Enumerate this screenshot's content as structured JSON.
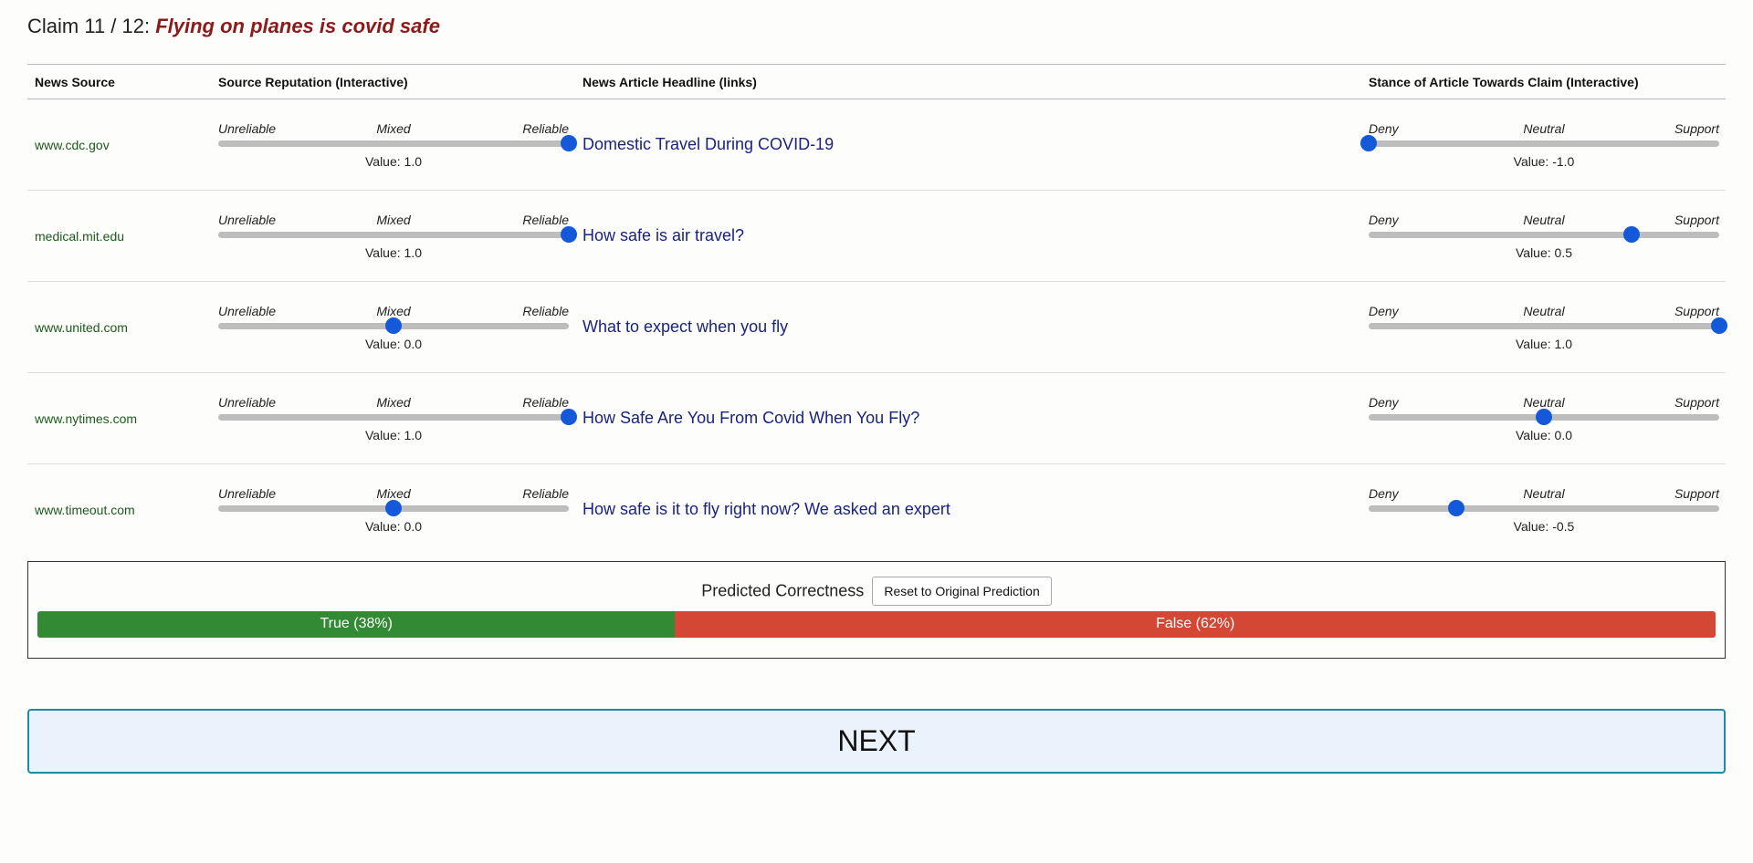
{
  "claim": {
    "prefix": "Claim 11 / 12: ",
    "text": "Flying on planes is covid safe"
  },
  "table": {
    "headers": {
      "source": "News Source",
      "reputation": "Source Reputation (Interactive)",
      "headline": "News Article Headline (links)",
      "stance": "Stance of Article Towards Claim (Interactive)"
    },
    "reputation_labels": [
      "Unreliable",
      "Mixed",
      "Reliable"
    ],
    "stance_labels": [
      "Deny",
      "Neutral",
      "Support"
    ],
    "value_prefix": "Value: ",
    "scale": [
      -1,
      1
    ],
    "rows": [
      {
        "source": "www.cdc.gov",
        "reputation": 1.0,
        "reputation_text": "1.0",
        "headline": "Domestic Travel During COVID-19",
        "stance": -1.0,
        "stance_text": "-1.0"
      },
      {
        "source": "medical.mit.edu",
        "reputation": 1.0,
        "reputation_text": "1.0",
        "headline": "How safe is air travel?",
        "stance": 0.5,
        "stance_text": "0.5"
      },
      {
        "source": "www.united.com",
        "reputation": 0.0,
        "reputation_text": "0.0",
        "headline": "What to expect when you fly",
        "stance": 1.0,
        "stance_text": "1.0"
      },
      {
        "source": "www.nytimes.com",
        "reputation": 1.0,
        "reputation_text": "1.0",
        "headline": "How Safe Are You From Covid When You Fly?",
        "stance": 0.0,
        "stance_text": "0.0"
      },
      {
        "source": "www.timeout.com",
        "reputation": 0.0,
        "reputation_text": "0.0",
        "headline": "How safe is it to fly right now? We asked an expert",
        "stance": -0.5,
        "stance_text": "-0.5"
      }
    ]
  },
  "prediction": {
    "title": "Predicted Correctness",
    "reset_label": "Reset to Original Prediction",
    "true_label": "True (38%)",
    "false_label": "False (62%)",
    "true_fraction": 0.38,
    "false_fraction": 0.62,
    "true_color": "#338a35",
    "false_color": "#d44735"
  },
  "next_label": "NEXT",
  "colors": {
    "claim": "#8b1a1a",
    "source_link": "#1c5a1c",
    "headline_link": "#1a237e",
    "knob": "#1459d9"
  }
}
